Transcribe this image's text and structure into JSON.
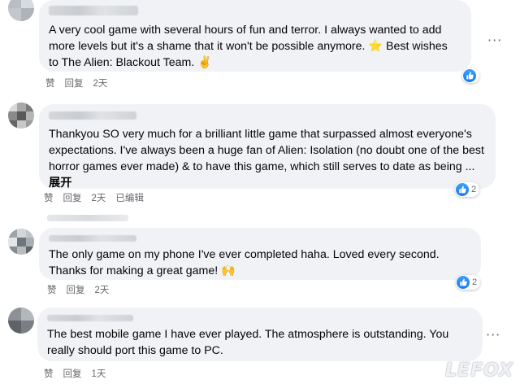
{
  "comments": [
    {
      "text_before": "A very cool game with several hours of fun and terror. I always wanted to add more levels but it's a shame that it won't be possible anymore. ",
      "emoji1": "⭐",
      "text_after": " Best wishes to The Alien: Blackout Team. ",
      "emoji2": "✌",
      "actions": {
        "like": "赞",
        "reply": "回复",
        "time": "2天"
      },
      "like_count": ""
    },
    {
      "text": "Thankyou SO very much for a brilliant little game that surpassed almost everyone's expectations. I've always been a huge fan of Alien: Isolation (no doubt one of the best horror games ever made) & to have this game, which still serves to date as being ... ",
      "more": "展开",
      "actions": {
        "like": "赞",
        "reply": "回复",
        "time": "2天",
        "edited": "已编辑"
      },
      "like_count": "2"
    },
    {
      "text": "The only game on my phone I've ever completed haha. Loved every second. Thanks for making a great game! ",
      "emoji": "🙌",
      "actions": {
        "like": "赞",
        "reply": "回复",
        "time": "2天"
      },
      "like_count": "2"
    },
    {
      "text": "The best mobile game I have ever played. The atmosphere is outstanding. You really should port this game to PC.",
      "actions": {
        "like": "赞",
        "reply": "回复",
        "time": "1天"
      },
      "like_count": ""
    }
  ],
  "icons": {
    "like": "thumbs-up-icon",
    "more": "more-options-icon"
  },
  "colors": {
    "like_blue": "#1877f2",
    "bubble": "#f0f2f5",
    "meta_gray": "#65676b"
  }
}
